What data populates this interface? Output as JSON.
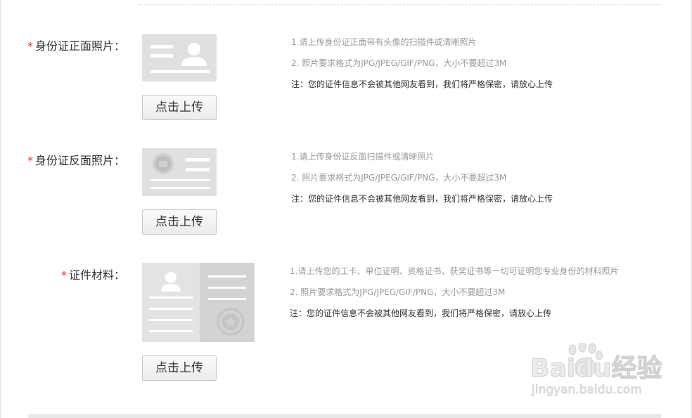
{
  "sections": [
    {
      "label": "身份证正面照片：",
      "required_mark": "*",
      "upload_label": "点击上传",
      "tips": [
        "1.请上传身份证正面带有头像的扫描件或清晰照片",
        "2. 照片要求格式为JPG/JPEG/GIF/PNG，大小不要超过3M",
        "注：您的证件信息不会被其他网友看到，我们将严格保密，请放心上传"
      ]
    },
    {
      "label": "身份证反面照片：",
      "required_mark": "*",
      "upload_label": "点击上传",
      "tips": [
        "1.请上传身份证反面扫描件或清晰照片",
        "2. 照片要求格式为JPG/JPEG/GIF/PNG，大小不要超过3M",
        "注：您的证件信息不会被其他网友看到，我们将严格保密，请放心上传"
      ]
    },
    {
      "label": "证件材料：",
      "required_mark": "*",
      "upload_label": "点击上传",
      "tips": [
        "1.请上传您的工卡、单位证明、资格证书、获奖证书等一切可证明您专业身份的材料照片",
        "2. 照片要求格式为JPG/JPEG/GIF/PNG，大小不要超过3M",
        "注：您的证件信息不会被其他网友看到，我们将严格保密，请放心上传"
      ]
    }
  ],
  "watermark": {
    "brand": "Baidu经验",
    "url": "jingyan.baidu.com"
  },
  "colors": {
    "required": "#e4393c",
    "placeholder_bg": "#e0e0e0",
    "placeholder_fg": "#ffffff",
    "tip_gray": "#999999"
  }
}
